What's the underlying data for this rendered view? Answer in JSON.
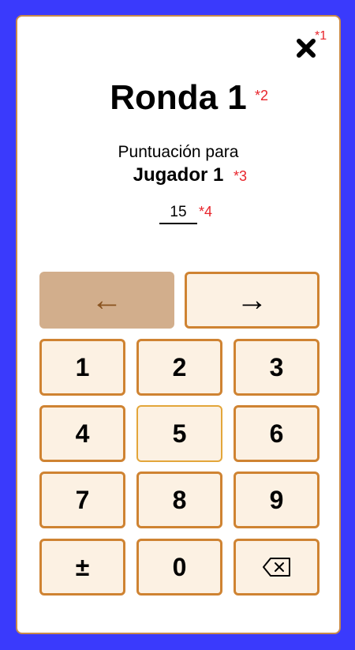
{
  "close": {
    "icon": "close-icon",
    "note": "*1"
  },
  "round": {
    "title": "Ronda 1",
    "note": "*2"
  },
  "prompt": {
    "label": "Puntuación para",
    "player": "Jugador 1",
    "note": "*3"
  },
  "score": {
    "value": "15",
    "note": "*4"
  },
  "nav": {
    "prev": "←",
    "next": "→"
  },
  "keypad": {
    "k1": "1",
    "k2": "2",
    "k3": "3",
    "k4": "4",
    "k5": "5",
    "k6": "6",
    "k7": "7",
    "k8": "8",
    "k9": "9",
    "sign": "±",
    "k0": "0",
    "backspace_icon": "backspace-icon"
  },
  "colors": {
    "background": "#3a3afc",
    "card_border": "#c98a4a",
    "button_fill": "#fcf1e3",
    "button_border": "#cf8332",
    "disabled_fill": "#d2ae8c",
    "note": "#e8242b"
  }
}
